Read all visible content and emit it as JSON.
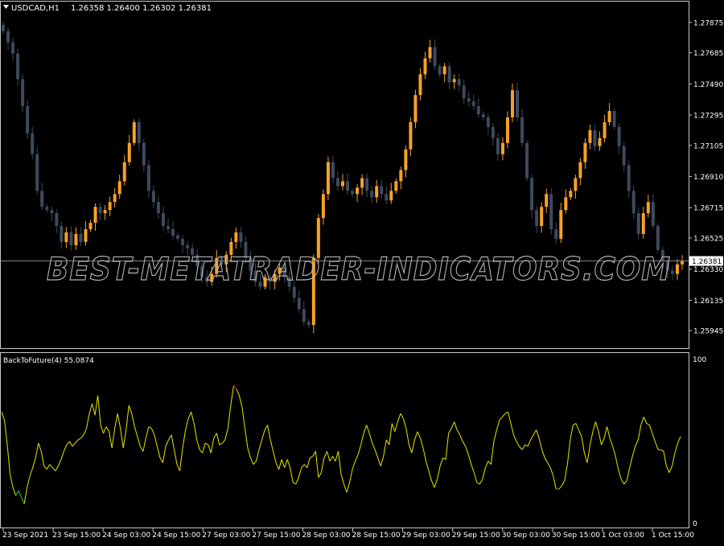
{
  "symbol_header": "USDCAD,H1",
  "ohlc_header": "1.26358 1.26400 1.26302 1.26381",
  "watermark": "BEST-METATRADER-INDICATORS.COM",
  "colors": {
    "background": "#000000",
    "frame": "#c8c8c8",
    "text": "#ffffff",
    "bull": "#f7a128",
    "bear": "#3d4a5c",
    "bid_line": "#808080",
    "osc_mid": "#e6e600",
    "osc_high": "#ff2a2a",
    "osc_low": "#2ec83a"
  },
  "chart_data": [
    {
      "type": "candlestick",
      "title": "USDCAD,H1",
      "ylim": [
        1.2584,
        1.28
      ],
      "y_ticks": [
        "1.27875",
        "1.27685",
        "1.27490",
        "1.27295",
        "1.27105",
        "1.26910",
        "1.26715",
        "1.26525",
        "1.26330",
        "1.26135",
        "1.25945"
      ],
      "current_price": "1.26381",
      "x_ticks": [
        "23 Sep 2021",
        "23 Sep 15:00",
        "24 Sep 03:00",
        "24 Sep 15:00",
        "27 Sep 03:00",
        "27 Sep 15:00",
        "28 Sep 03:00",
        "28 Sep 15:00",
        "29 Sep 03:00",
        "29 Sep 15:00",
        "30 Sep 03:00",
        "30 Sep 15:00",
        "1 Oct 03:00",
        "1 Oct 15:00"
      ],
      "close_values": [
        1.2782,
        1.2775,
        1.2768,
        1.2752,
        1.2735,
        1.2718,
        1.2705,
        1.2682,
        1.2672,
        1.267,
        1.2668,
        1.266,
        1.265,
        1.2656,
        1.2648,
        1.2655,
        1.265,
        1.2658,
        1.2662,
        1.2672,
        1.2668,
        1.267,
        1.2675,
        1.268,
        1.2688,
        1.27,
        1.2712,
        1.2725,
        1.2712,
        1.2698,
        1.2682,
        1.2675,
        1.2668,
        1.266,
        1.2658,
        1.2654,
        1.2652,
        1.2648,
        1.2646,
        1.2642,
        1.2635,
        1.2628,
        1.2625,
        1.263,
        1.264,
        1.2636,
        1.2642,
        1.265,
        1.2656,
        1.265,
        1.264,
        1.2632,
        1.2625,
        1.2622,
        1.2628,
        1.2625,
        1.263,
        1.2634,
        1.2628,
        1.2622,
        1.2615,
        1.2608,
        1.26,
        1.2598,
        1.264,
        1.2665,
        1.268,
        1.27,
        1.269,
        1.2685,
        1.2688,
        1.2682,
        1.268,
        1.2684,
        1.269,
        1.2682,
        1.2678,
        1.2685,
        1.268,
        1.2676,
        1.2682,
        1.2688,
        1.2695,
        1.2708,
        1.2725,
        1.2742,
        1.2755,
        1.2765,
        1.2772,
        1.276,
        1.2755,
        1.276,
        1.275,
        1.2752,
        1.2748,
        1.274,
        1.2738,
        1.2735,
        1.273,
        1.2728,
        1.2722,
        1.2715,
        1.2705,
        1.2712,
        1.2728,
        1.2745,
        1.2728,
        1.2712,
        1.269,
        1.267,
        1.266,
        1.2672,
        1.268,
        1.2658,
        1.2652,
        1.267,
        1.2678,
        1.2682,
        1.269,
        1.27,
        1.2712,
        1.272,
        1.271,
        1.2715,
        1.2725,
        1.2732,
        1.2722,
        1.271,
        1.2698,
        1.2682,
        1.2668,
        1.2655,
        1.2668,
        1.2675,
        1.266,
        1.2645,
        1.2638,
        1.2632,
        1.263,
        1.2636,
        1.2638
      ]
    },
    {
      "type": "line",
      "title": "BackToFuture(4) 55.0874",
      "ylim": [
        0,
        100
      ],
      "y_ticks": [
        "100",
        "0"
      ],
      "values": [
        68,
        63,
        48,
        30,
        22,
        17,
        20,
        16,
        12,
        22,
        29,
        34,
        40,
        49,
        44,
        35,
        33,
        36,
        34,
        32,
        35,
        39,
        44,
        48,
        50,
        47,
        49,
        51,
        52,
        54,
        58,
        67,
        73,
        66,
        78,
        60,
        55,
        59,
        56,
        46,
        58,
        67,
        58,
        46,
        57,
        72,
        67,
        59,
        53,
        47,
        44,
        52,
        59,
        58,
        54,
        47,
        40,
        37,
        47,
        51,
        54,
        45,
        36,
        32,
        46,
        57,
        64,
        68,
        61,
        51,
        45,
        43,
        49,
        48,
        43,
        52,
        55,
        48,
        49,
        51,
        58,
        72,
        84,
        82,
        78,
        71,
        58,
        46,
        40,
        36,
        38,
        45,
        51,
        57,
        60,
        51,
        44,
        37,
        33,
        39,
        34,
        39,
        34,
        25,
        24,
        28,
        34,
        36,
        34,
        40,
        41,
        44,
        28,
        31,
        40,
        44,
        38,
        41,
        38,
        44,
        30,
        24,
        19,
        25,
        33,
        38,
        42,
        48,
        55,
        60,
        55,
        49,
        45,
        40,
        35,
        41,
        51,
        48,
        61,
        56,
        62,
        67,
        64,
        58,
        48,
        43,
        51,
        56,
        52,
        46,
        38,
        32,
        26,
        22,
        27,
        35,
        40,
        39,
        55,
        58,
        62,
        57,
        54,
        50,
        47,
        42,
        36,
        31,
        25,
        24,
        27,
        34,
        38,
        36,
        50,
        57,
        63,
        65,
        67,
        68,
        61,
        54,
        50,
        47,
        45,
        48,
        47,
        51,
        54,
        57,
        52,
        45,
        40,
        37,
        34,
        29,
        21,
        21,
        23,
        26,
        36,
        51,
        60,
        61,
        57,
        53,
        43,
        37,
        48,
        56,
        62,
        56,
        48,
        52,
        59,
        52,
        47,
        41,
        33,
        27,
        24,
        26,
        34,
        41,
        47,
        51,
        60,
        65,
        61,
        60,
        55,
        50,
        45,
        45,
        44,
        35,
        31,
        35,
        43,
        49,
        53
      ]
    }
  ]
}
